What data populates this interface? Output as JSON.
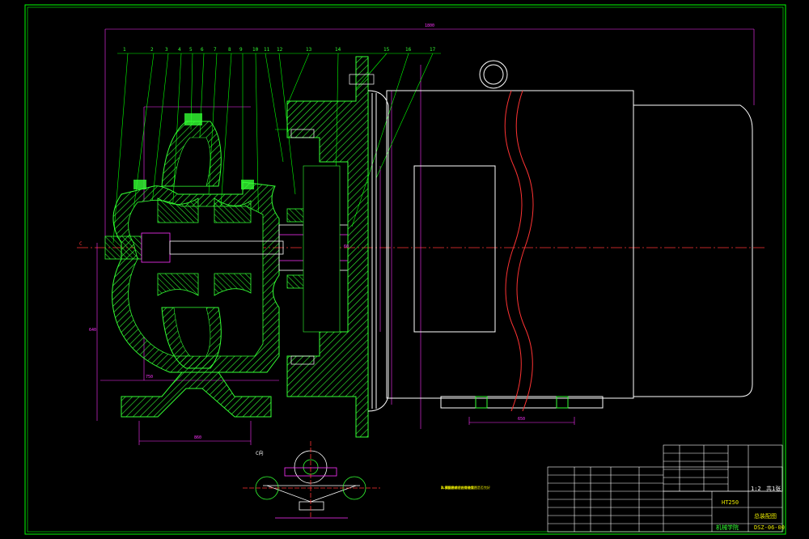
{
  "drawing": {
    "part_numbers": [
      "1",
      "2",
      "3",
      "4",
      "5",
      "6",
      "7",
      "8",
      "9",
      "10",
      "11",
      "12",
      "13",
      "14",
      "15",
      "16",
      "17",
      "18"
    ],
    "overall_dim": "1800",
    "base_dim": "860",
    "motor_base_dim": "650",
    "height_dim": "640",
    "small_dim_a": "60",
    "small_dim_b": "750",
    "left_mark": "C"
  },
  "view2": {
    "label": "C向"
  },
  "tech_notes": {
    "title": "技术要求",
    "lines": [
      "1.泵安装前应检查各零件是否完好",
      "2.装配后转子应转动灵活",
      "3.试压合格后方可使用"
    ]
  },
  "title_block": {
    "part_name": "HT250",
    "drawing_title": "总装配图",
    "drawing_code": "DSZ-06-00",
    "scale": "1:2",
    "sheet": "共1张",
    "school": "机械学院"
  },
  "colors": {
    "background": "#000000",
    "border": "#00ff00",
    "leader": "#00ff00",
    "dimension": "#ff33ff",
    "centerline": "#ff3333",
    "outline": "#ffffff",
    "hatch": "#33ff33"
  }
}
